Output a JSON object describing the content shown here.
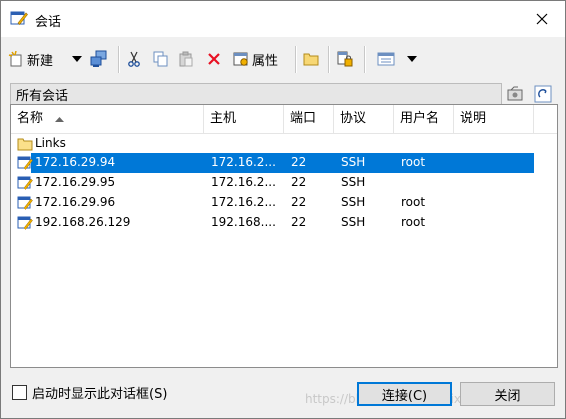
{
  "window": {
    "title": "会话"
  },
  "toolbar": {
    "new_label": "新建",
    "properties_label": "属性"
  },
  "panel": {
    "title": "所有会话"
  },
  "columns": [
    "名称",
    "主机",
    "端口",
    "协议",
    "用户名",
    "说明"
  ],
  "folder": {
    "name": "Links"
  },
  "sessions": [
    {
      "name": "172.16.29.94",
      "host": "172.16.2...",
      "port": "22",
      "protocol": "SSH",
      "user": "root",
      "selected": true
    },
    {
      "name": "172.16.29.95",
      "host": "172.16.2...",
      "port": "22",
      "protocol": "SSH",
      "user": ""
    },
    {
      "name": "172.16.29.96",
      "host": "172.16.2...",
      "port": "22",
      "protocol": "SSH",
      "user": "root"
    },
    {
      "name": "192.168.26.129",
      "host": "192.168....",
      "port": "22",
      "protocol": "SSH",
      "user": "root"
    }
  ],
  "footer": {
    "show_on_startup_label": "启动时显示此对话框(S)",
    "connect_label": "连接(C)",
    "close_label": "关闭"
  },
  "watermark": "https://blog.csdn.net/weixin_4...3880",
  "colors": {
    "selection": "#0078d7",
    "accent": "#0078d7",
    "delete": "#e81123"
  }
}
